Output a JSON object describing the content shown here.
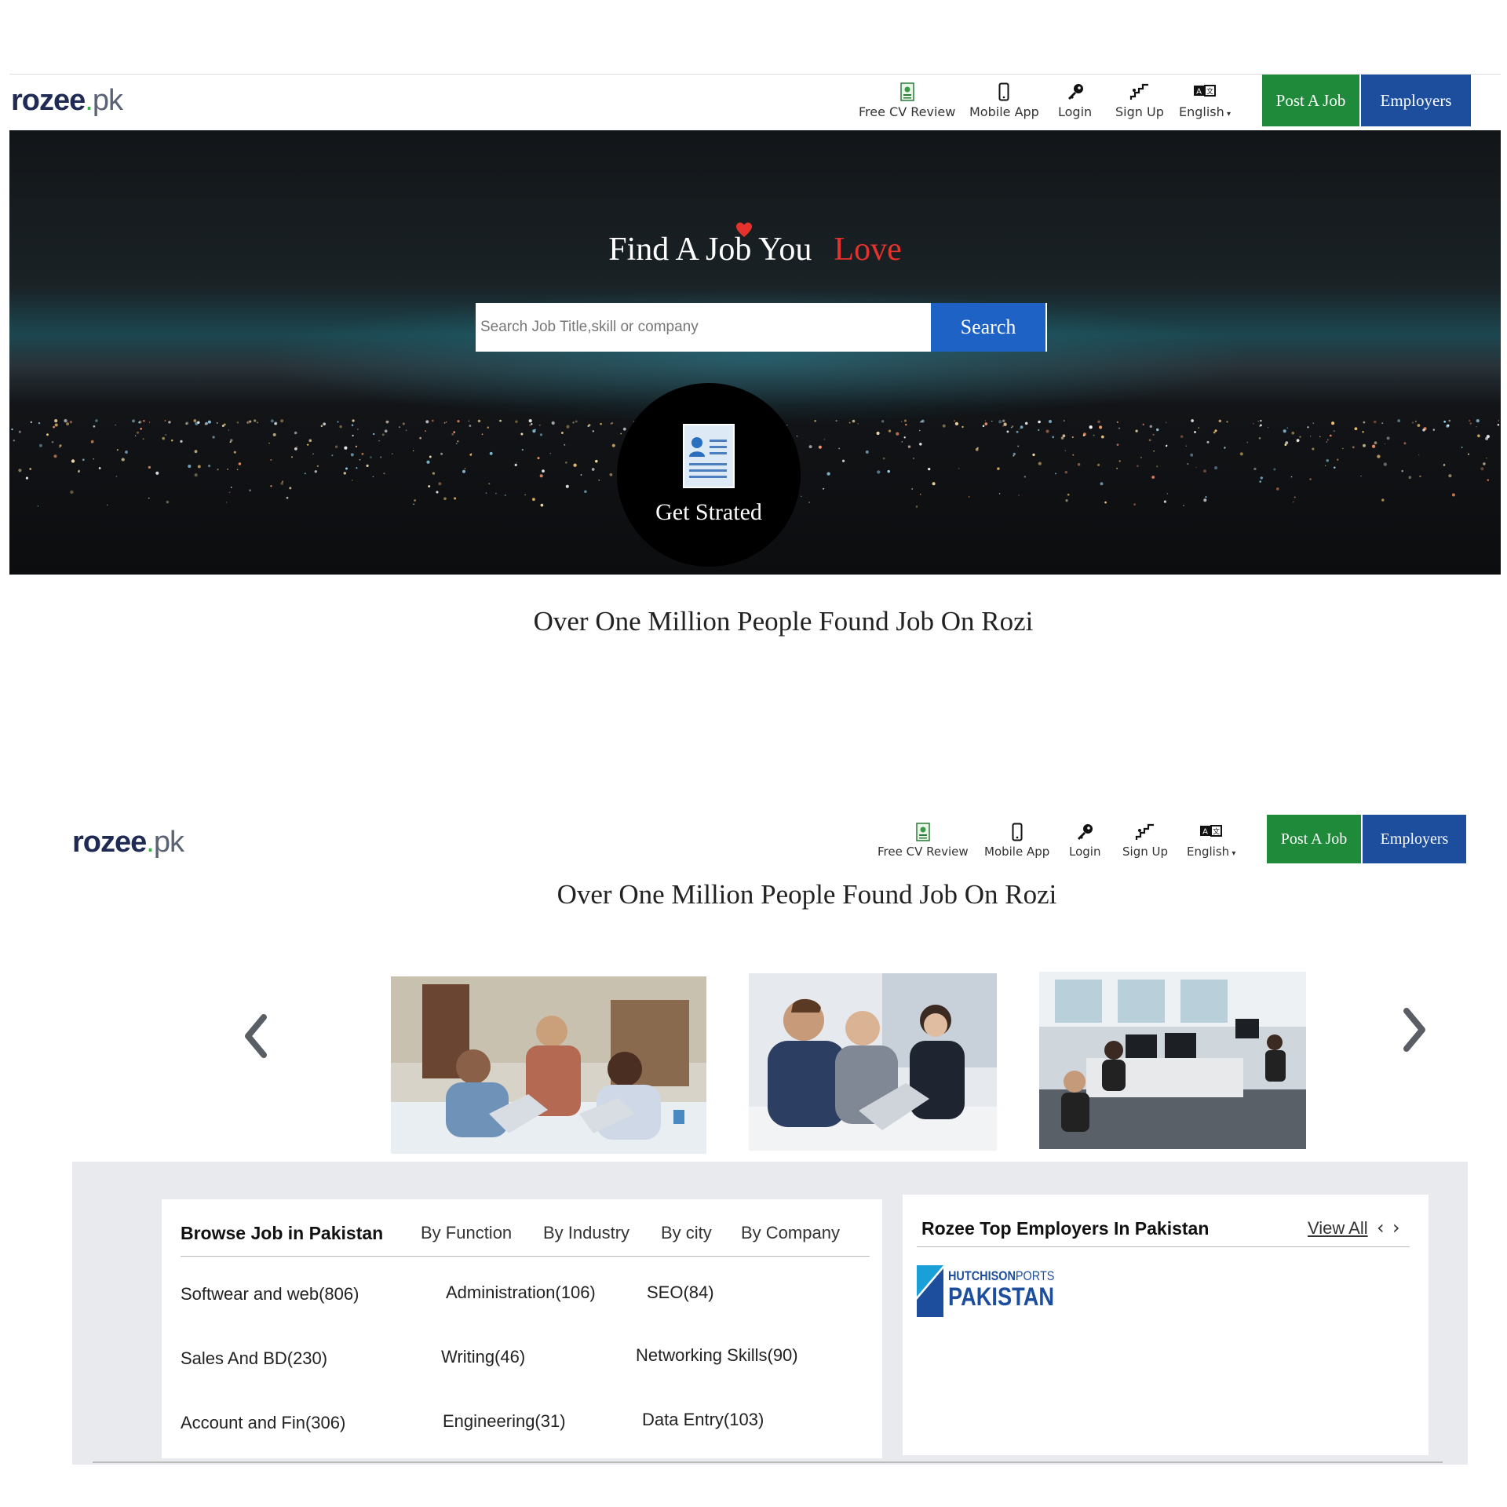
{
  "brand": {
    "name_main": "rozee",
    "name_tld": "pk",
    "dot": "."
  },
  "nav": {
    "items": [
      {
        "label": "Free CV Review",
        "icon": "cv-review-icon"
      },
      {
        "label": "Mobile App",
        "icon": "mobile-icon"
      },
      {
        "label": "Login",
        "icon": "key-icon"
      },
      {
        "label": "Sign Up",
        "icon": "stairs-icon"
      },
      {
        "label": "English",
        "icon": "language-icon"
      }
    ],
    "post_job": "Post A Job",
    "employers": "Employers"
  },
  "hero": {
    "title_main": "Find A Job You",
    "title_accent": "Love",
    "search_placeholder": "Search Job Title,skill or company",
    "search_button": "Search",
    "get_started": "Get Strated"
  },
  "tagline": "Over One Million People Found Job On Rozi",
  "browse": {
    "heading": "Browse Job in Pakistan",
    "tabs": [
      "By Function",
      "By Industry",
      "By city",
      "By Company"
    ],
    "categories": [
      [
        "Softwear and web(806)",
        "Administration(106)",
        "SEO(84)"
      ],
      [
        "Sales And BD(230)",
        "Writing(46)",
        "Networking Skills(90)"
      ],
      [
        "Account and Fin(306)",
        "Engineering(31)",
        "Data Entry(103)"
      ]
    ]
  },
  "employers_panel": {
    "heading": "Rozee Top Employers In Pakistan",
    "view_all": "View All",
    "prev": "‹",
    "next": "›",
    "logo_line1_bold": "HUTCHISON",
    "logo_line1_light": "PORTS",
    "logo_line2": "PAKISTAN"
  },
  "colors": {
    "post_job_bg": "#1f8b3a",
    "employers_bg": "#1d4e9e",
    "search_btn_bg": "#1d62c4",
    "accent_red": "#e5322d",
    "panel_bg": "#e9eaee"
  }
}
